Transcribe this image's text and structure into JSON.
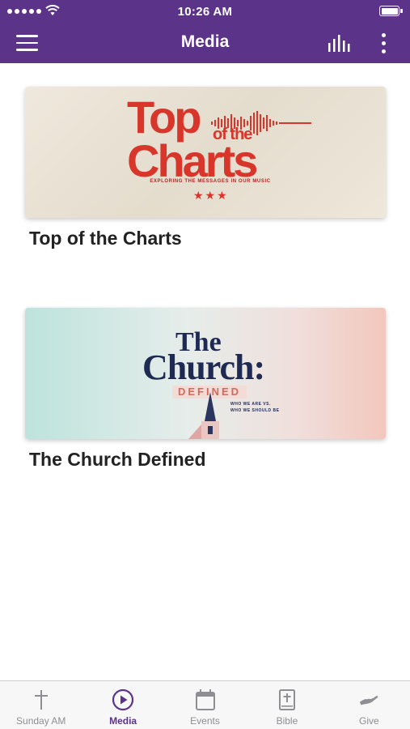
{
  "status_bar": {
    "time": "10:26 AM"
  },
  "nav": {
    "title": "Media"
  },
  "media_items": [
    {
      "title": "Top of the Charts",
      "artwork": {
        "line1": "Top",
        "line2": "of the",
        "line3": "Charts",
        "tagline": "EXPLORING THE MESSAGES IN OUR MUSIC"
      }
    },
    {
      "title": "The Church Defined",
      "artwork": {
        "line1": "The",
        "line2": "Church:",
        "line3": "DEFINED",
        "subtext_1": "WHO WE ARE VS.",
        "subtext_2": "WHO WE SHOULD BE"
      }
    }
  ],
  "tabs": [
    {
      "label": "Sunday AM",
      "icon": "cross-icon",
      "active": false
    },
    {
      "label": "Media",
      "icon": "play-circle-icon",
      "active": true
    },
    {
      "label": "Events",
      "icon": "calendar-icon",
      "active": false
    },
    {
      "label": "Bible",
      "icon": "bible-icon",
      "active": false
    },
    {
      "label": "Give",
      "icon": "give-hand-icon",
      "active": false
    }
  ],
  "colors": {
    "brand": "#5b3388",
    "tab_inactive": "#8e8e93"
  }
}
